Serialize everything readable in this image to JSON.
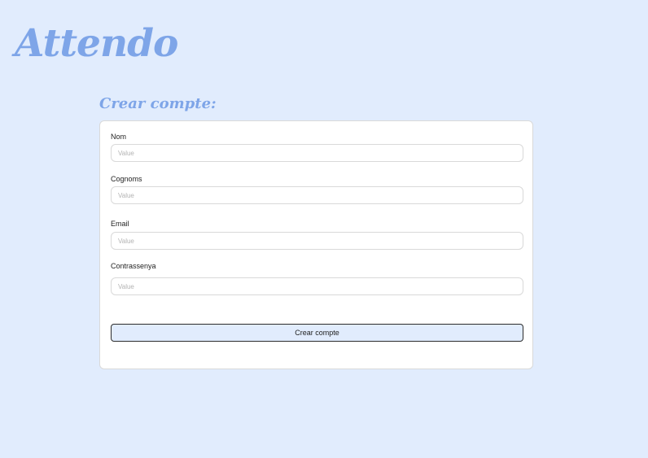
{
  "app": {
    "logo_text": "Attendo"
  },
  "form": {
    "title": "Crear compte:",
    "fields": [
      {
        "label": "Nom",
        "placeholder": "Value",
        "value": ""
      },
      {
        "label": "Cognoms",
        "placeholder": "Value",
        "value": ""
      },
      {
        "label": "Email",
        "placeholder": "Value",
        "value": ""
      },
      {
        "label": "Contrassenya",
        "placeholder": "Value",
        "value": ""
      }
    ],
    "submit_label": "Crear compte"
  },
  "colors": {
    "background": "#e1ecfd",
    "accent": "#7ea5e8",
    "card": "#ffffff",
    "border": "#d9d9d9",
    "button_border": "#2c2c2c"
  }
}
